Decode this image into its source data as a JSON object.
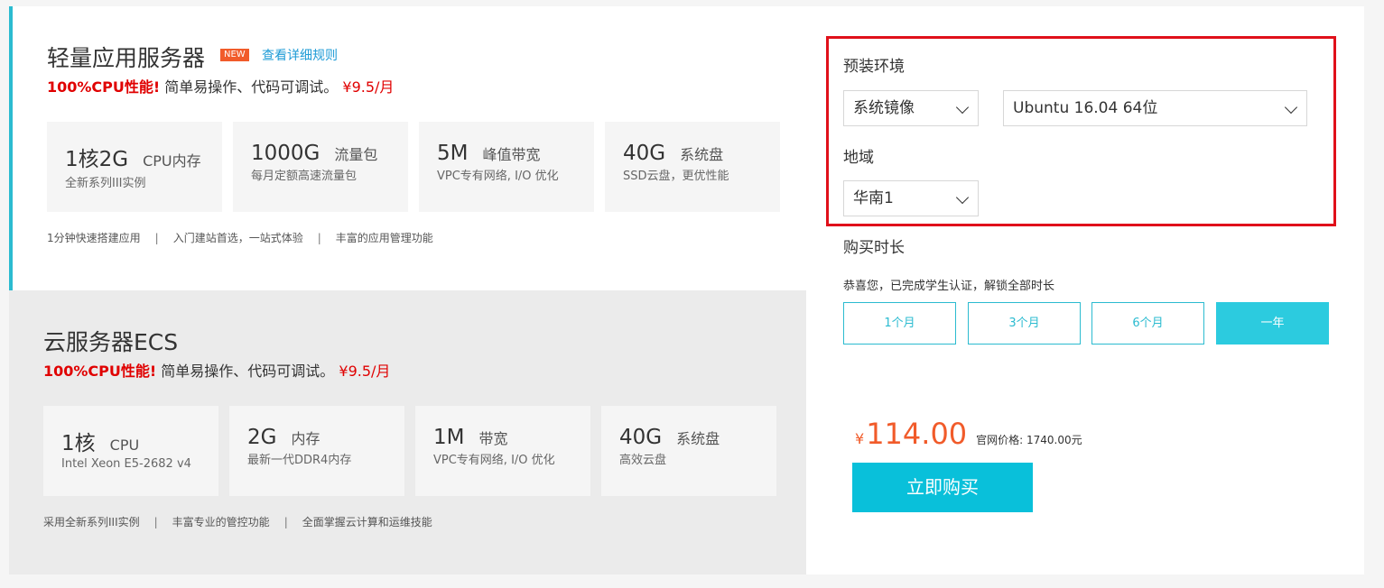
{
  "lighthouse": {
    "title": "轻量应用服务器",
    "badge": "NEW",
    "rule_link": "查看详细规则",
    "promo_highlight": "100%CPU性能!",
    "promo_text": "简单易操作、代码可调试。",
    "promo_price": "¥9.5/月",
    "specs": [
      {
        "value": "1核2G",
        "unit": "CPU内存",
        "desc": "全新系列III实例"
      },
      {
        "value": "1000G",
        "unit": "流量包",
        "desc": "每月定额高速流量包"
      },
      {
        "value": "5M",
        "unit": "峰值带宽",
        "desc": "VPC专有网络, I/O 优化"
      },
      {
        "value": "40G",
        "unit": "系统盘",
        "desc": "SSD云盘，更优性能"
      }
    ],
    "features": [
      "1分钟快速搭建应用",
      "入门建站首选，一站式体验",
      "丰富的应用管理功能"
    ],
    "separator": "|"
  },
  "ecs": {
    "title": "云服务器ECS",
    "promo_highlight": "100%CPU性能!",
    "promo_text": "简单易操作、代码可调试。",
    "promo_price": "¥9.5/月",
    "specs": [
      {
        "value": "1核",
        "unit": "CPU",
        "desc": "Intel Xeon E5-2682 v4"
      },
      {
        "value": "2G",
        "unit": "内存",
        "desc": "最新一代DDR4内存"
      },
      {
        "value": "1M",
        "unit": "带宽",
        "desc": "VPC专有网络, I/O 优化"
      },
      {
        "value": "40G",
        "unit": "系统盘",
        "desc": "高效云盘"
      }
    ],
    "features": [
      "采用全新系列III实例",
      "丰富专业的管控功能",
      "全面掌握云计算和运维技能"
    ],
    "separator": "|"
  },
  "config": {
    "env_label": "预装环境",
    "image_type": "系统镜像",
    "os": "Ubuntu 16.04 64位",
    "region_label": "地域",
    "region": "华南1",
    "duration_label": "购买时长",
    "student_note": "恭喜您，已完成学生认证，解锁全部时长",
    "durations": [
      "1个月",
      "3个月",
      "6个月",
      "一年"
    ],
    "selected_duration": "一年",
    "currency": "¥",
    "price": "114.00",
    "original_price": "官网价格: 1740.00元",
    "buy_label": "立即购买"
  },
  "colors": {
    "accent": "#2bbbd0",
    "active_duration": "#2ccbdf",
    "buy_button": "#09c0da",
    "price": "#f15b2a",
    "promo_red": "#e00000",
    "highlight_box": "#e0101a"
  },
  "icons": {
    "select_arrow": "chevron-down-icon"
  }
}
